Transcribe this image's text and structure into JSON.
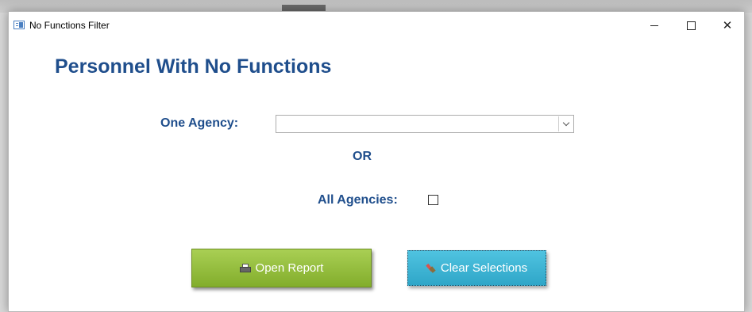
{
  "window": {
    "title": "No Functions Filter",
    "minimize_glyph": "—",
    "maximize_glyph": "☐",
    "close_glyph": "✕"
  },
  "form": {
    "heading": "Personnel With No Functions",
    "agency_label": "One Agency:",
    "agency_value": "",
    "or_label": "OR",
    "all_agencies_label": "All Agencies:",
    "all_agencies_checked": false
  },
  "buttons": {
    "open_report": "Open Report",
    "clear_selections": "Clear Selections"
  },
  "icons": {
    "app": "form-icon",
    "open_report": "printer-icon",
    "clear_selections": "eraser-icon"
  },
  "colors": {
    "heading": "#1f4e8c",
    "open_button": "#8fbc3a",
    "clear_button": "#3bb3d6"
  }
}
